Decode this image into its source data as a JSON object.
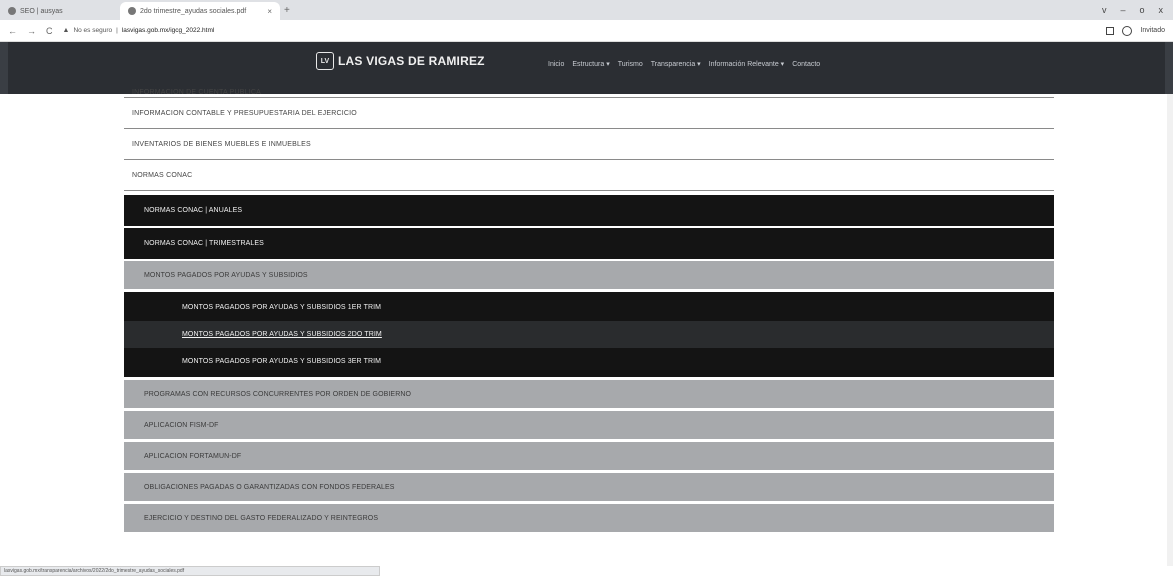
{
  "browser": {
    "tabs": [
      {
        "title": "SEO | ausyas",
        "active": false
      },
      {
        "title": "2do trimestre_ayudas sociales.pdf",
        "active": true
      }
    ],
    "new_tab": "+",
    "url_warning": "No es seguro",
    "url": "lasvigas.gob.mx/igcg_2022.html",
    "profile_label": "Invitado",
    "window_controls": [
      "v",
      "–",
      "o",
      "x"
    ],
    "status_url": "lasvigas.gob.mx/transparencia/archivos/2022/2do_trimestre_ayudas_sociales.pdf"
  },
  "site": {
    "logo_mark": "LV",
    "logo_text": "LAS VIGAS DE RAMIREZ",
    "nav": [
      "Inicio",
      "Estructura ▾",
      "Turismo",
      "Transparencia ▾",
      "Información Relevante ▾",
      "Contacto"
    ]
  },
  "content": {
    "white_rows": [
      "INFORMACION DE CUENTA PUBLICA",
      "INFORMACION CONTABLE Y PRESUPUESTARIA DEL EJERCICIO",
      "INVENTARIOS DE BIENES MUEBLES E INMUEBLES",
      "NORMAS CONAC"
    ],
    "black_rows": [
      "NORMAS CONAC | ANUALES",
      "NORMAS CONAC | TRIMESTRALES"
    ],
    "gray_row_montos": "MONTOS PAGADOS POR AYUDAS Y SUBSIDIOS",
    "sub_rows": [
      "MONTOS PAGADOS POR AYUDAS Y SUBSIDIOS 1ER TRIM",
      "MONTOS PAGADOS POR AYUDAS Y SUBSIDIOS 2DO TRIM",
      "MONTOS PAGADOS POR AYUDAS Y SUBSIDIOS 3ER TRIM"
    ],
    "gray_rows": [
      "PROGRAMAS CON RECURSOS CONCURRENTES POR ORDEN DE GOBIERNO",
      "APLICACION FISM-DF",
      "APLICACION FORTAMUN-DF",
      "OBLIGACIONES PAGADAS O GARANTIZADAS CON FONDOS FEDERALES",
      "EJERCICIO Y DESTINO DEL GASTO FEDERALIZADO Y REINTEGROS"
    ]
  }
}
